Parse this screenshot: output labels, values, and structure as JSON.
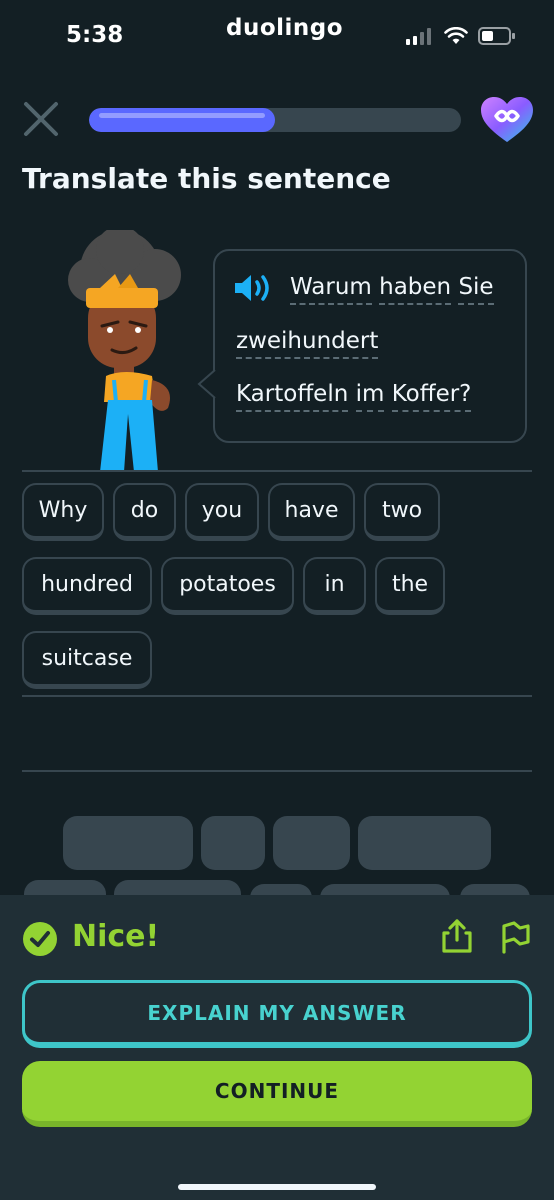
{
  "status_bar": {
    "time": "5:38",
    "carrier": "duolingo"
  },
  "lesson": {
    "progress": 0.5,
    "prompt": "Translate this sentence"
  },
  "speech": {
    "lines": [
      [
        "Warum",
        "haben",
        "Sie"
      ],
      [
        "zweihundert"
      ],
      [
        "Kartoffeln",
        "im",
        "Koffer?"
      ]
    ]
  },
  "answer_tiles": [
    [
      "Why",
      "do",
      "you",
      "have",
      "two"
    ],
    [
      "hundred",
      "potatoes",
      "in",
      "the"
    ],
    [
      "suitcase"
    ]
  ],
  "feedback": {
    "message": "Nice!",
    "explain_label": "EXPLAIN MY ANSWER",
    "continue_label": "CONTINUE"
  },
  "colors": {
    "background": "#131f24",
    "progress": "#5a68ff",
    "success": "#93d333",
    "accent_teal": "#3ec6c9",
    "speaker": "#1cb0f6"
  },
  "icons": [
    "close-icon",
    "infinity-heart-icon",
    "speaker-icon",
    "check-circle-icon",
    "share-icon",
    "flag-icon",
    "signal-icon",
    "wifi-icon",
    "battery-icon"
  ]
}
